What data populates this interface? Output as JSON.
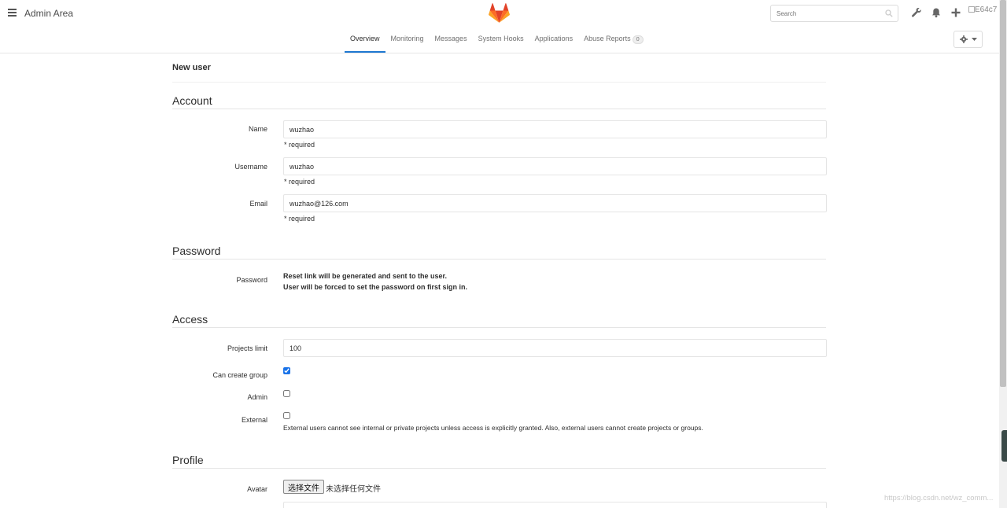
{
  "header": {
    "title": "Admin Area",
    "search_placeholder": "Search",
    "avatar_alt": "E64c7"
  },
  "nav": {
    "tabs": [
      {
        "label": "Overview",
        "active": true
      },
      {
        "label": "Monitoring"
      },
      {
        "label": "Messages"
      },
      {
        "label": "System Hooks"
      },
      {
        "label": "Applications"
      },
      {
        "label": "Abuse Reports",
        "badge": "0"
      }
    ]
  },
  "page": {
    "title": "New user"
  },
  "account": {
    "heading": "Account",
    "name_label": "Name",
    "name_value": "wuzhao",
    "name_help": "* required",
    "username_label": "Username",
    "username_value": "wuzhao",
    "username_help": "* required",
    "email_label": "Email",
    "email_value": "wuzhao@126.com",
    "email_help": "* required"
  },
  "password": {
    "heading": "Password",
    "label": "Password",
    "line1": "Reset link will be generated and sent to the user.",
    "line2": "User will be forced to set the password on first sign in."
  },
  "access": {
    "heading": "Access",
    "projects_limit_label": "Projects limit",
    "projects_limit_value": "100",
    "can_create_group_label": "Can create group",
    "can_create_group": true,
    "admin_label": "Admin",
    "admin": false,
    "external_label": "External",
    "external": false,
    "external_help": "External users cannot see internal or private projects unless access is explicitly granted. Also, external users cannot create projects or groups."
  },
  "profile": {
    "heading": "Profile",
    "avatar_label": "Avatar",
    "file_button": "选择文件",
    "file_status": "未选择任何文件"
  },
  "watermark": "https://blog.csdn.net/wz_comm...",
  "colors": {
    "active_tab": "#1f78d1",
    "checkbox_checked": "#1a73e8"
  }
}
